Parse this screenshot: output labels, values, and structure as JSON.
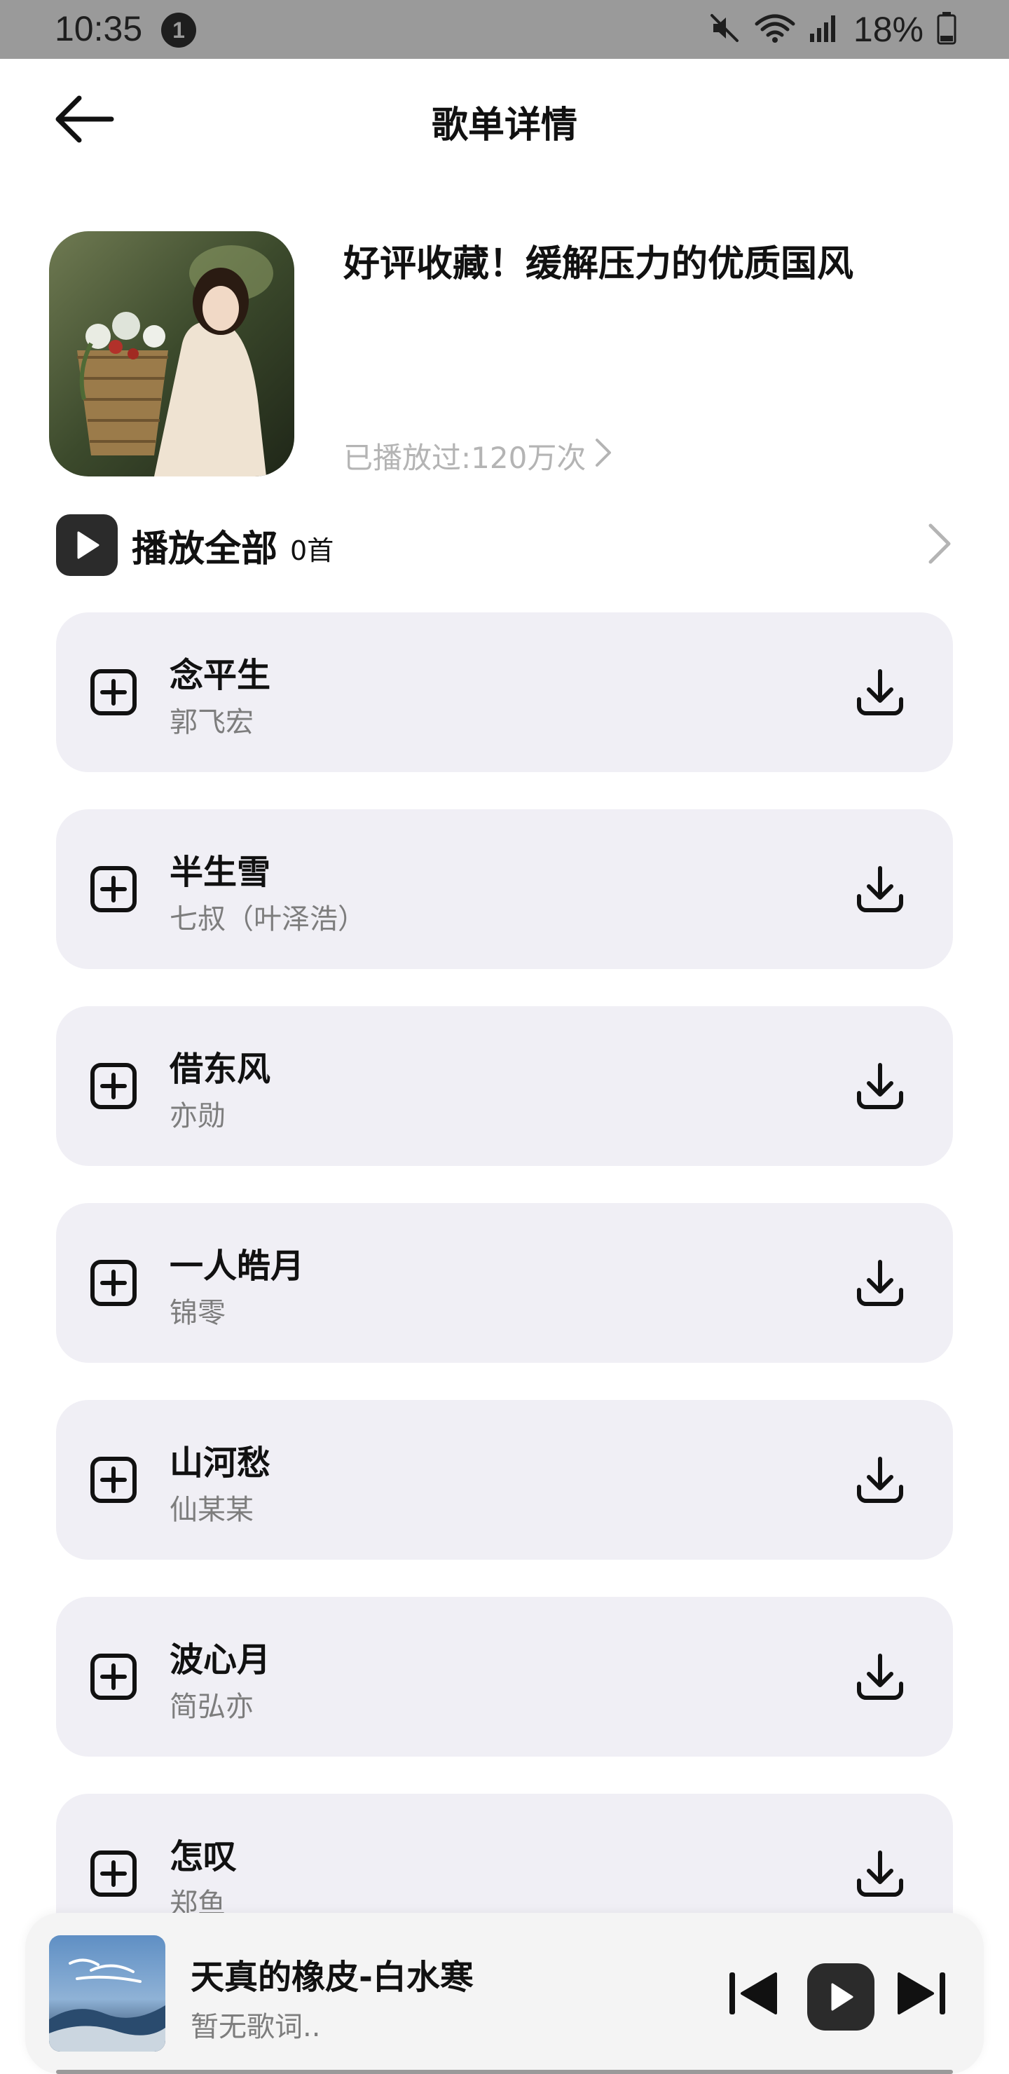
{
  "status_bar": {
    "time": "10:35",
    "notification_count": "1",
    "battery": "18%",
    "icons": [
      "mute-icon",
      "wifi-icon",
      "signal-icon",
      "battery-icon"
    ]
  },
  "header": {
    "title": "歌单详情",
    "back_icon": "arrow-left-icon"
  },
  "playlist": {
    "title": "好评收藏！缓解压力的优质国风",
    "plays": "已播放过:120万次"
  },
  "play_all": {
    "label": "播放全部",
    "count": "0首"
  },
  "songs": [
    {
      "title": "念平生",
      "artist": "郭飞宏"
    },
    {
      "title": "半生雪",
      "artist": "七叔（叶泽浩）"
    },
    {
      "title": "借东风",
      "artist": "亦勋"
    },
    {
      "title": "一人皓月",
      "artist": "锦零"
    },
    {
      "title": "山河愁",
      "artist": "仙某某"
    },
    {
      "title": "波心月",
      "artist": "简弘亦"
    },
    {
      "title": "怎叹",
      "artist": "郑鱼"
    }
  ],
  "mini_player": {
    "title": "天真的橡皮-白水寒",
    "lyric": "暂无歌词.."
  },
  "colors": {
    "card_bg": "#f0eff5",
    "dark": "#2b2b2b",
    "muted_text": "#7d7d7d",
    "status_bar": "#9a9a9a"
  }
}
